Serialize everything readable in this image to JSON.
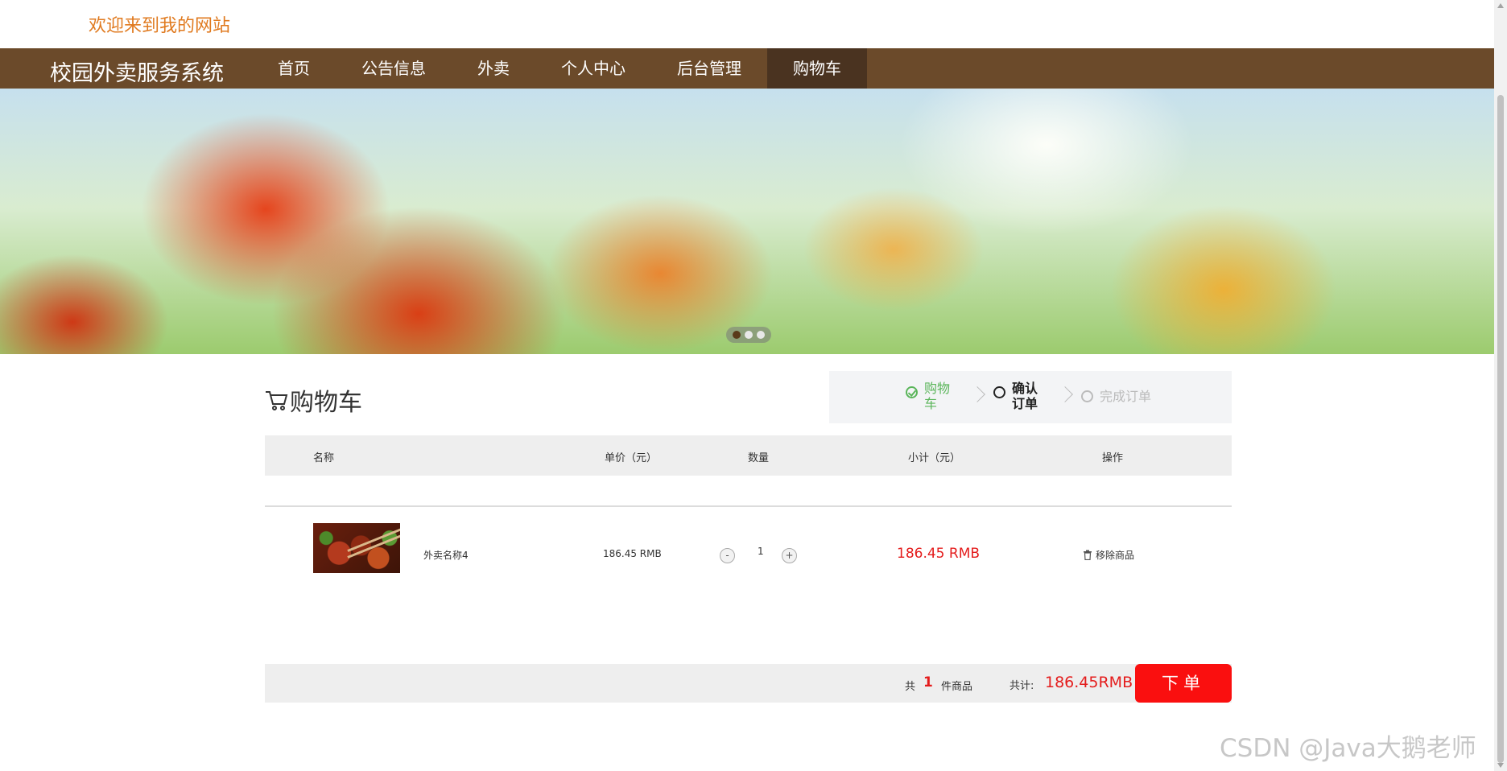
{
  "header": {
    "welcome": "欢迎来到我的网站"
  },
  "nav": {
    "brand": "校园外卖服务系统",
    "items": [
      {
        "label": "首页"
      },
      {
        "label": "公告信息"
      },
      {
        "label": "外卖"
      },
      {
        "label": "个人中心"
      },
      {
        "label": "后台管理"
      },
      {
        "label": "购物车",
        "active": true
      }
    ]
  },
  "banner": {
    "slides": 3,
    "active_slide": 1
  },
  "cart": {
    "title": "购物车",
    "steps": [
      {
        "label": "购物车",
        "state": "done"
      },
      {
        "label": "确认订单",
        "state": "current"
      },
      {
        "label": "完成订单",
        "state": "pending"
      }
    ],
    "columns": [
      "名称",
      "单价（元）",
      "数量",
      "小计（元）",
      "操作"
    ],
    "items": [
      {
        "name": "外卖名称4",
        "price": "186.45 RMB",
        "qty": "1",
        "minus": "-",
        "plus": "+",
        "subtotal": "186.45 RMB",
        "remove": "移除商品"
      }
    ],
    "footer": {
      "count_prefix": "共",
      "count": "1",
      "count_suffix": "件商品",
      "total_label": "共计:",
      "total": "186.45RMB",
      "submit": "下单"
    }
  },
  "watermark": "CSDN @Java大鹅老师",
  "colors": {
    "nav": "#6b4a2a",
    "accent": "#e41c1c",
    "welcome": "#e07a1f",
    "step_done": "#5ab55a"
  }
}
